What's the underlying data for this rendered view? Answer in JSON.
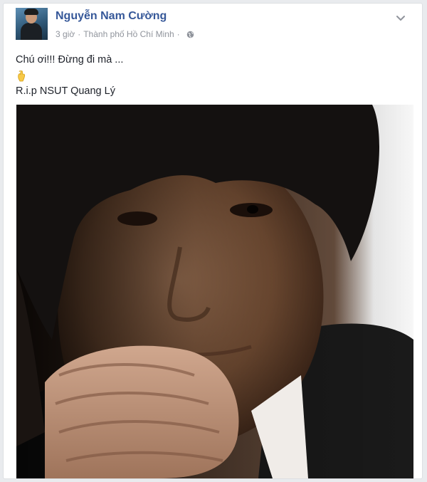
{
  "post": {
    "author": "Nguyễn Nam Cường",
    "time": "3 giờ",
    "separator": "·",
    "location": "Thành phố Hồ Chí Minh",
    "separator2": "·",
    "privacy_icon": "globe-icon",
    "menu_icon": "chevron-down-icon",
    "text_line1": "Chú ơi!!! Đừng đi mà ...",
    "emoji_icon": "hand-emoji-icon",
    "text_line2": "R.i.p NSUT Quang Lý"
  },
  "colors": {
    "name": "#365899",
    "meta": "#90949c",
    "text": "#1d2129",
    "background": "#e9ebee"
  }
}
